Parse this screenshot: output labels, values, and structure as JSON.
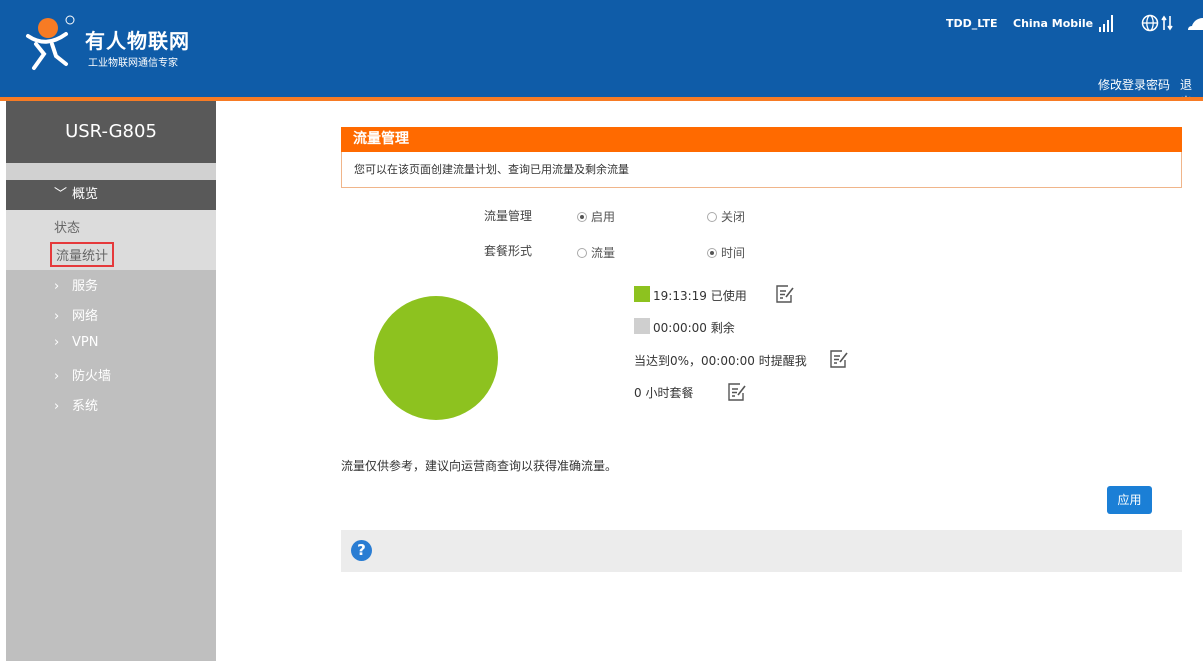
{
  "header": {
    "brand_name": "有人物联网",
    "brand_sub": "工业物联网通信专家",
    "network_type": "TDD_LTE",
    "carrier": "China Mobile",
    "change_password": "修改登录密码",
    "logout": "退出"
  },
  "sidebar": {
    "device": "USR-G805",
    "group": "概览",
    "subitems": [
      "状态",
      "流量统计"
    ],
    "items": [
      "服务",
      "网络",
      "VPN",
      "防火墙",
      "系统"
    ]
  },
  "panel": {
    "title": "流量管理",
    "description": "您可以在该页面创建流量计划、查询已用流量及剩余流量"
  },
  "form": {
    "management_label": "流量管理",
    "management_options": [
      "启用",
      "关闭"
    ],
    "management_selected": "启用",
    "plan_label": "套餐形式",
    "plan_options": [
      "流量",
      "时间"
    ],
    "plan_selected": "时间"
  },
  "usage": {
    "used_text": "19:13:19 已使用",
    "remaining_text": "00:00:00 剩余",
    "alert_text": "当达到0%，00:00:00 时提醒我",
    "plan_text": "0 小时套餐",
    "used_fraction": 1.0,
    "used_color": "#8dc21f",
    "remaining_color": "#cfcfcf"
  },
  "note": "流量仅供参考，建议向运营商查询以获得准确流量。",
  "apply_label": "应用",
  "help_symbol": "?"
}
